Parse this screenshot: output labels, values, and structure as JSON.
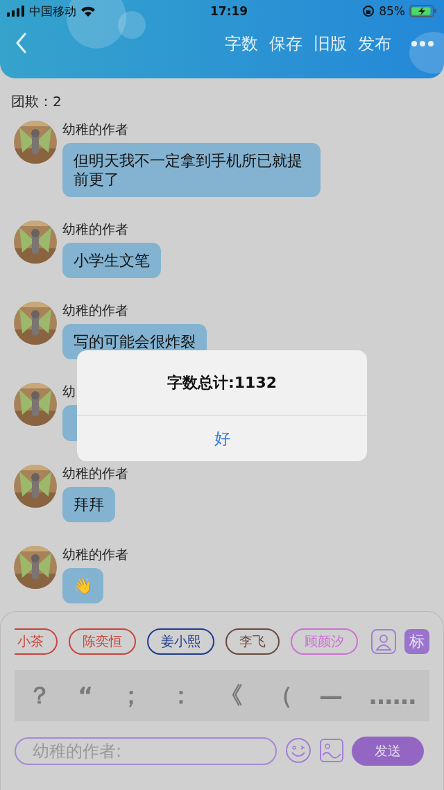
{
  "status_bar": {
    "carrier": "中国移动",
    "time": "17:19",
    "battery": "85%"
  },
  "header": {
    "actions": [
      "字数",
      "保存",
      "旧版",
      "发布"
    ]
  },
  "group_count": "团欺：2",
  "messages": [
    {
      "name": "幼稚的作者",
      "text": "但明天我不一定拿到手机所已就提前更了"
    },
    {
      "name": "幼稚的作者",
      "text": "小学生文笔"
    },
    {
      "name": "幼稚的作者",
      "text": "写的可能会很炸裂"
    },
    {
      "name": "幼"
    },
    {
      "name": "幼稚的作者",
      "text": "拜拜"
    },
    {
      "name": "幼稚的作者",
      "text": "👋"
    }
  ],
  "character_tags": [
    {
      "label": "小茶",
      "color": "#c8463c",
      "cut": true
    },
    {
      "label": "陈奕恒",
      "color": "#c8463c",
      "cut": false
    },
    {
      "label": "姜小熙",
      "color": "#1f3c8c",
      "cut": false
    },
    {
      "label": "李飞",
      "color": "#6a4a3e",
      "cut": false
    },
    {
      "label": "顾颜汐",
      "color": "#cf6fd6",
      "cut": false
    }
  ],
  "tag_button": "标",
  "punctuation": [
    "？",
    "“",
    "；",
    "：",
    "《",
    "（",
    "—",
    "……"
  ],
  "input": {
    "placeholder": "幼稚的作者:"
  },
  "send_button": "发送",
  "alert": {
    "title": "字数总计:1132",
    "button": "好"
  }
}
